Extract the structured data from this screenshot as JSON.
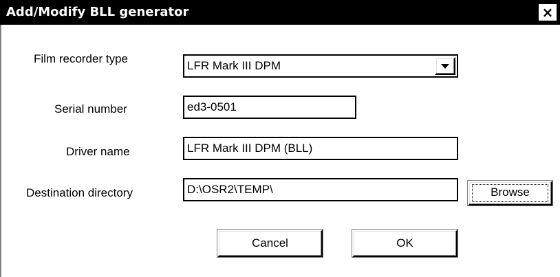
{
  "dialog": {
    "title": "Add/Modify BLL generator",
    "close_glyph": "×"
  },
  "form": {
    "film_recorder_type": {
      "label": "Film recorder type",
      "value": "LFR Mark III DPM"
    },
    "serial_number": {
      "label": "Serial number",
      "value": "ed3-0501"
    },
    "driver_name": {
      "label": "Driver name",
      "value": "LFR Mark III DPM (BLL)"
    },
    "destination_directory": {
      "label": "Destination directory",
      "value": "D:\\OSR2\\TEMP\\"
    }
  },
  "buttons": {
    "browse": "Browse",
    "cancel": "Cancel",
    "ok": "OK"
  },
  "icons": {
    "close": "close-icon",
    "dropdown": "chevron-down-icon"
  },
  "colors": {
    "titlebar": "#000000",
    "title_text": "#ffffff",
    "background": "#ffffff"
  }
}
